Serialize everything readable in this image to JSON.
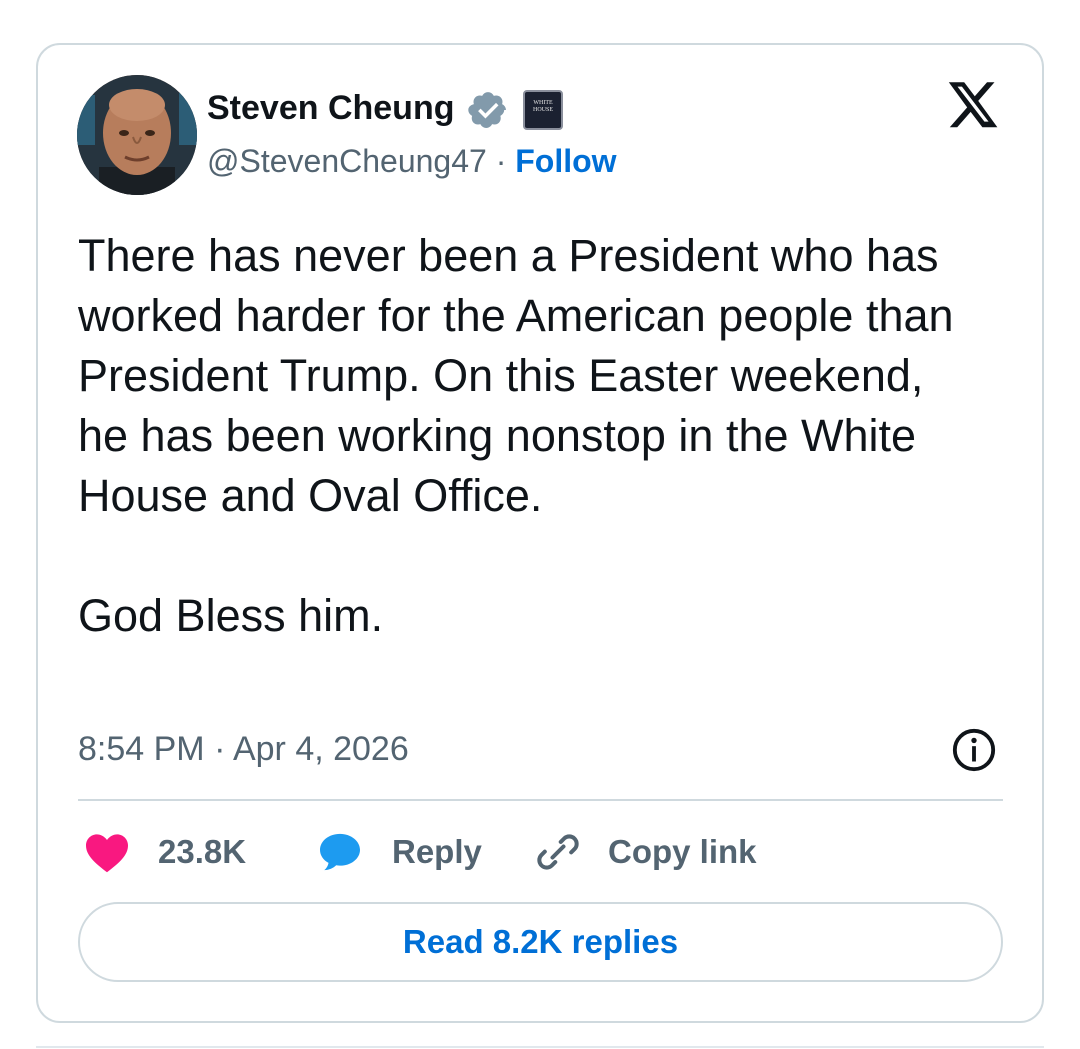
{
  "tweet": {
    "author_name": "Steven Cheung",
    "handle": "@StevenCheung47",
    "separator": "·",
    "follow_label": "Follow",
    "affiliation_badge_text": "WHITE HOUSE",
    "text": "There has never been a President who has worked harder for the American people than President Trump. On this Easter weekend, he has been working nonstop in the White House and Oval Office.\n\nGod Bless him.",
    "timestamp": "8:54 PM · Apr 4, 2026"
  },
  "actions": {
    "like_count": "23.8K",
    "reply_label": "Reply",
    "copy_link_label": "Copy link"
  },
  "read_replies_label": "Read 8.2K replies",
  "icons": {
    "verified": "verified-badge-icon",
    "affiliation": "white-house-affiliation-icon",
    "platform": "x-logo-icon",
    "info": "info-icon",
    "like": "heart-icon",
    "reply": "speech-bubble-icon",
    "copy_link": "link-icon"
  },
  "colors": {
    "follow_blue": "#006fd6",
    "heart_pink": "#f91880",
    "reply_blue": "#1d9bf0",
    "verified_gray": "#829aab",
    "muted_text": "#536471",
    "border": "#cfd9de"
  }
}
